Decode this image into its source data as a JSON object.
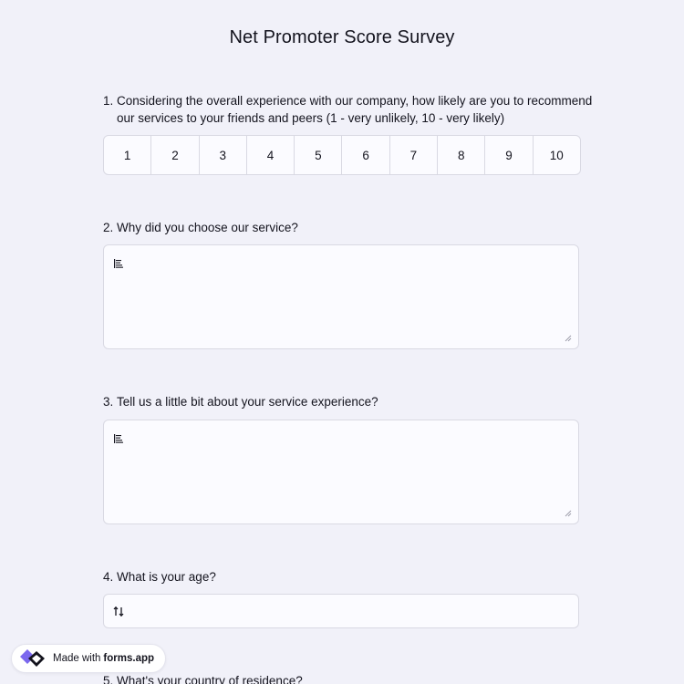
{
  "survey": {
    "title": "Net Promoter Score Survey"
  },
  "questions": [
    {
      "number": "1.",
      "text": "Considering the overall experience with our company, how likely are you to recommend our services to your friends and peers (1 - very unlikely, 10 - very likely)",
      "scale": [
        "1",
        "2",
        "3",
        "4",
        "5",
        "6",
        "7",
        "8",
        "9",
        "10"
      ]
    },
    {
      "number": "2.",
      "text": "Why did you choose our service?",
      "icon": "text-lines-icon"
    },
    {
      "number": "3.",
      "text": "Tell us a little bit about your service experience?",
      "icon": "text-lines-icon"
    },
    {
      "number": "4.",
      "text": "What is your age?",
      "icon": "sort-numeric-icon"
    },
    {
      "number": "5.",
      "text": "What's your country of residence?"
    }
  ],
  "badge": {
    "prefix": "Made with",
    "brand": "forms.app",
    "logo_icon": "forms-app-logo-icon",
    "logo_colors": [
      "#7b68ee",
      "#14141e"
    ]
  },
  "colors": {
    "background": "#f1f1f9",
    "field_background": "#fbfbff",
    "border": "#d9d9e3",
    "text": "#14141e"
  }
}
